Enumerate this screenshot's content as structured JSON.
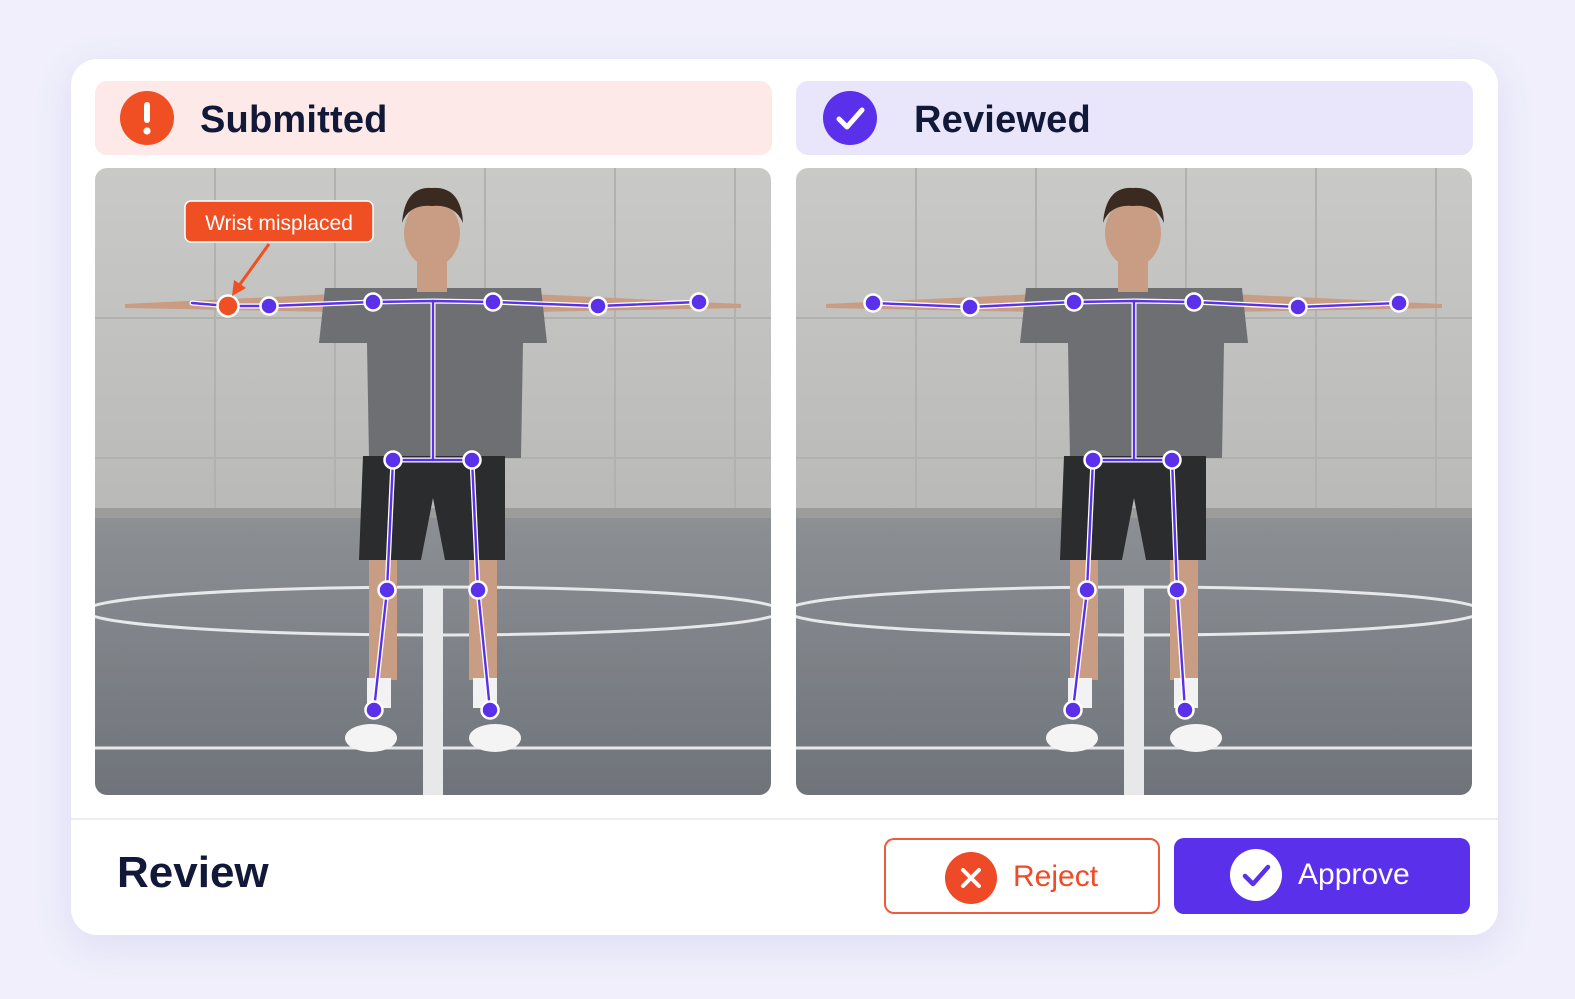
{
  "submitted": {
    "title": "Submitted",
    "icon": "exclamation-icon",
    "annotation": "Wrist misplaced"
  },
  "reviewed": {
    "title": "Reviewed",
    "icon": "checkmark-icon"
  },
  "footer": {
    "title": "Review",
    "reject_label": "Reject",
    "approve_label": "Approve"
  },
  "colors": {
    "skeleton": "#5b30ea",
    "error": "#f04e23",
    "reviewed_header_bg": "#e9e6fb",
    "submitted_header_bg": "#fde9e7"
  }
}
